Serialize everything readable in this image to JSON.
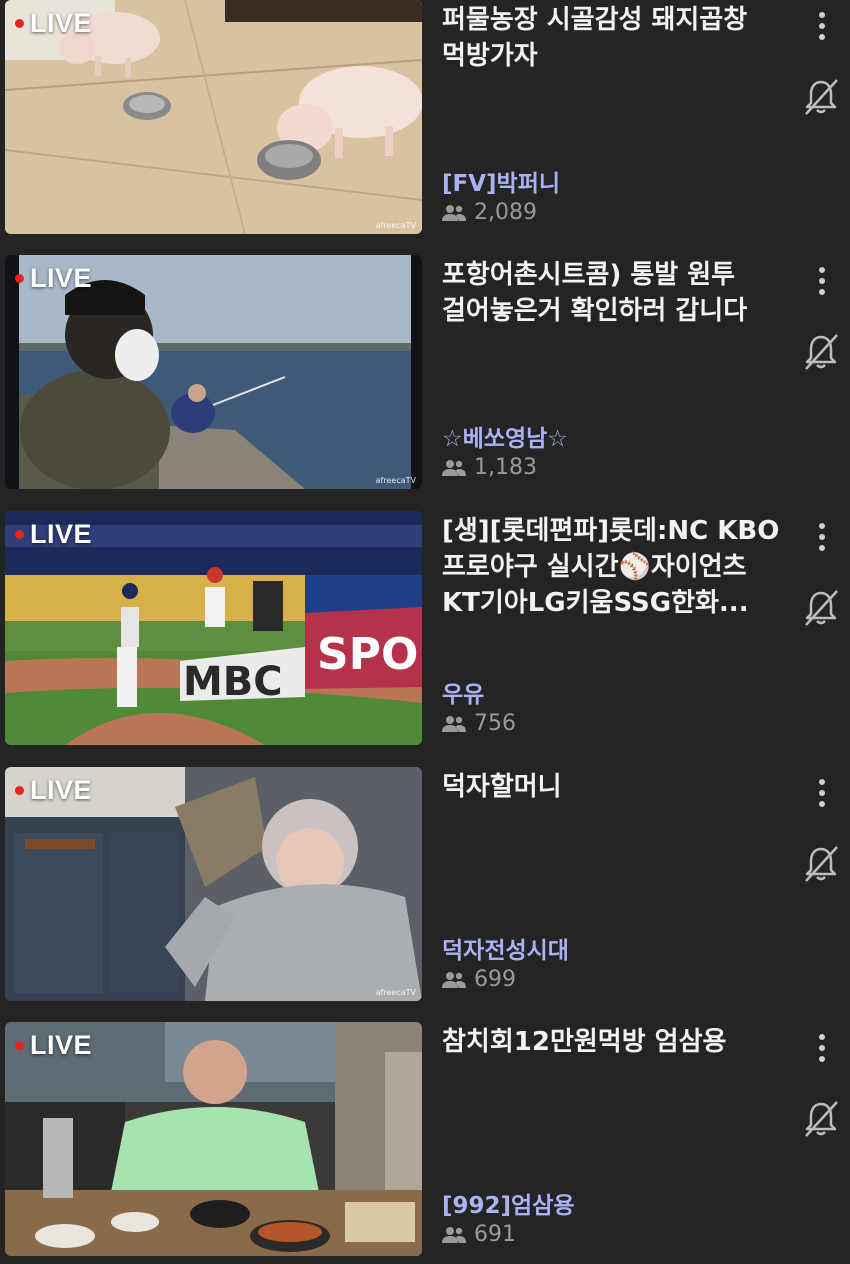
{
  "live_label": "LIVE",
  "watermark": "afreecaTV",
  "icons": {
    "more": "more-vertical-icon",
    "notify": "bell-off-icon",
    "viewers": "people-icon"
  },
  "colors": {
    "background": "#242424",
    "title": "#f2f2f2",
    "channel": "#a9b3f4",
    "viewers": "#9a9a9a",
    "live_dot": "#e8231f"
  },
  "streams": [
    {
      "title": "퍼물농장 시골감성 돼지곱창 먹방가자",
      "channel": "[FV]박퍼니",
      "viewers": "2,089",
      "thumbnail": "pigs"
    },
    {
      "title": "포항어촌시트콤) 통발 원투 걸어놓은거 확인하러 갑니다",
      "channel": "☆베쏘영남☆",
      "viewers": "1,183",
      "thumbnail": "fishing"
    },
    {
      "title": "[생][롯데편파]롯데:NC KBO 프로야구 실시간⚾자이언츠 KT기아LG키움SSG한화...",
      "channel": "우유",
      "viewers": "756",
      "thumbnail": "baseball"
    },
    {
      "title": "덕자할머니",
      "channel": "덕자전성시대",
      "viewers": "699",
      "thumbnail": "room"
    },
    {
      "title": "참치회12만원먹방 엄삼용",
      "channel": "[992]엄삼용",
      "viewers": "691",
      "thumbnail": "restaurant"
    }
  ]
}
